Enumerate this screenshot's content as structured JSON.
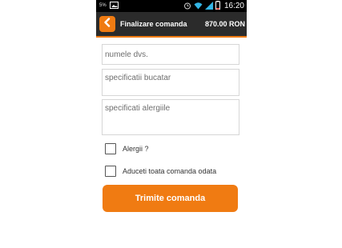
{
  "status_bar": {
    "battery_percent": "5%",
    "time": "16:20",
    "icons": [
      "image-icon",
      "alarm-icon",
      "wifi-icon",
      "signal-icon",
      "battery-icon"
    ]
  },
  "action_bar": {
    "title": "Finalizare comanda",
    "total": "870.00 RON",
    "back_icon": "chevron-left-icon"
  },
  "form": {
    "name_placeholder": "numele dvs.",
    "kitchen_placeholder": "specificatii bucatar",
    "allergy_placeholder": "specificati alergiile",
    "allergy_checkbox_label": "Alergii ?",
    "allergy_checked": false,
    "deliver_together_label": "Aduceti toata comanda odata",
    "deliver_together_checked": false,
    "submit_label": "Trimite comanda"
  },
  "colors": {
    "accent": "#f07b12",
    "action_bar_bg": "#2b2b2b",
    "status_bar_bg": "#000000"
  }
}
